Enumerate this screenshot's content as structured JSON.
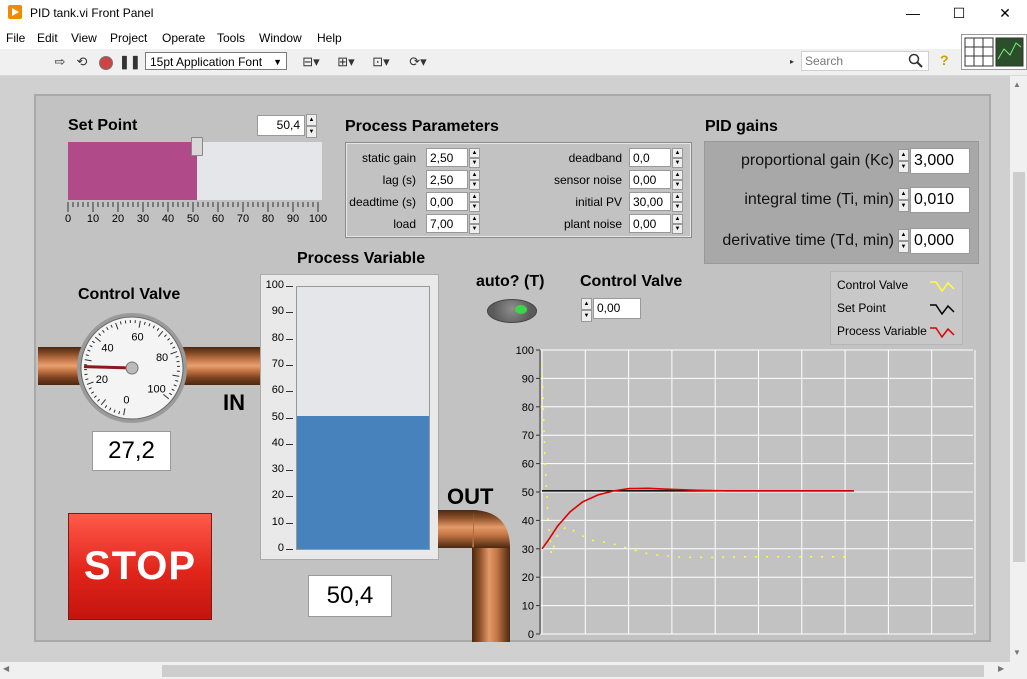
{
  "window": {
    "title": "PID tank.vi Front Panel",
    "min": "—",
    "max": "☐",
    "close": "✕"
  },
  "menu": [
    "File",
    "Edit",
    "View",
    "Project",
    "Operate",
    "Tools",
    "Window",
    "Help"
  ],
  "toolbar": {
    "font": "15pt Application Font",
    "search_placeholder": "Search",
    "help": "?"
  },
  "set_point": {
    "label": "Set Point",
    "value": "50,4",
    "fraction": 0.504,
    "ticks": [
      "0",
      "10",
      "20",
      "30",
      "40",
      "50",
      "60",
      "70",
      "80",
      "90",
      "100"
    ]
  },
  "process_parameters": {
    "title": "Process Parameters",
    "left": [
      {
        "label": "static gain",
        "value": "2,50"
      },
      {
        "label": "lag (s)",
        "value": "2,50"
      },
      {
        "label": "deadtime (s)",
        "value": "0,00"
      },
      {
        "label": "load",
        "value": "7,00"
      }
    ],
    "right": [
      {
        "label": "deadband",
        "value": "0,0"
      },
      {
        "label": "sensor noise",
        "value": "0,00"
      },
      {
        "label": "initial PV",
        "value": "30,00"
      },
      {
        "label": "plant noise",
        "value": "0,00"
      }
    ]
  },
  "pid_gains": {
    "title": "PID gains",
    "items": [
      {
        "label": "proportional gain (Kc)",
        "value": "3,000"
      },
      {
        "label": "integral time (Ti, min)",
        "value": "0,010"
      },
      {
        "label": "derivative time (Td, min)",
        "value": "0,000"
      }
    ]
  },
  "control_valve_gauge": {
    "label": "Control Valve",
    "value": "27,2",
    "ticks": [
      "0",
      "20",
      "40",
      "60",
      "80",
      "100"
    ],
    "in_label": "IN"
  },
  "process_variable": {
    "label": "Process Variable",
    "value": "50,4",
    "level": 50.4,
    "ticks": [
      "100",
      "90",
      "80",
      "70",
      "60",
      "50",
      "40",
      "30",
      "20",
      "10",
      "0"
    ],
    "out_label": "OUT"
  },
  "auto": {
    "label": "auto? (T)",
    "state": true
  },
  "control_valve_manual": {
    "label": "Control Valve",
    "value": "0,00"
  },
  "stop": {
    "label": "STOP"
  },
  "legend": [
    {
      "label": "Control Valve",
      "color": "#ffff33"
    },
    {
      "label": "Set Point",
      "color": "#000000"
    },
    {
      "label": "Process Variable",
      "color": "#dd0000"
    }
  ],
  "chart_data": {
    "type": "line",
    "ylim": [
      0,
      100
    ],
    "yticks": [
      "100",
      "90",
      "80",
      "70",
      "60",
      "50",
      "40",
      "30",
      "20",
      "10",
      "0"
    ],
    "grid": true,
    "series": [
      {
        "name": "Set Point",
        "color": "#000000",
        "x": [
          0,
          100
        ],
        "values": [
          50.4,
          50.4
        ]
      },
      {
        "name": "Process Variable",
        "color": "#dd0000",
        "x": [
          0,
          2,
          5,
          9,
          13,
          18,
          23,
          28,
          34,
          40,
          50,
          60,
          100
        ],
        "values": [
          30,
          33,
          38,
          43,
          46.5,
          49,
          50.4,
          51.2,
          51.3,
          51,
          50.6,
          50.4,
          50.4
        ]
      },
      {
        "name": "Control Valve",
        "color": "#ffff33",
        "x": [
          0,
          1,
          2,
          3,
          5,
          8,
          12,
          16,
          22,
          28,
          35,
          45,
          55,
          65,
          75,
          85,
          95,
          100
        ],
        "values": [
          95,
          60,
          40,
          28,
          35,
          38,
          35,
          33,
          32,
          30,
          28,
          27,
          27,
          27.2,
          27.2,
          27.2,
          27.2,
          27.2
        ]
      }
    ]
  }
}
